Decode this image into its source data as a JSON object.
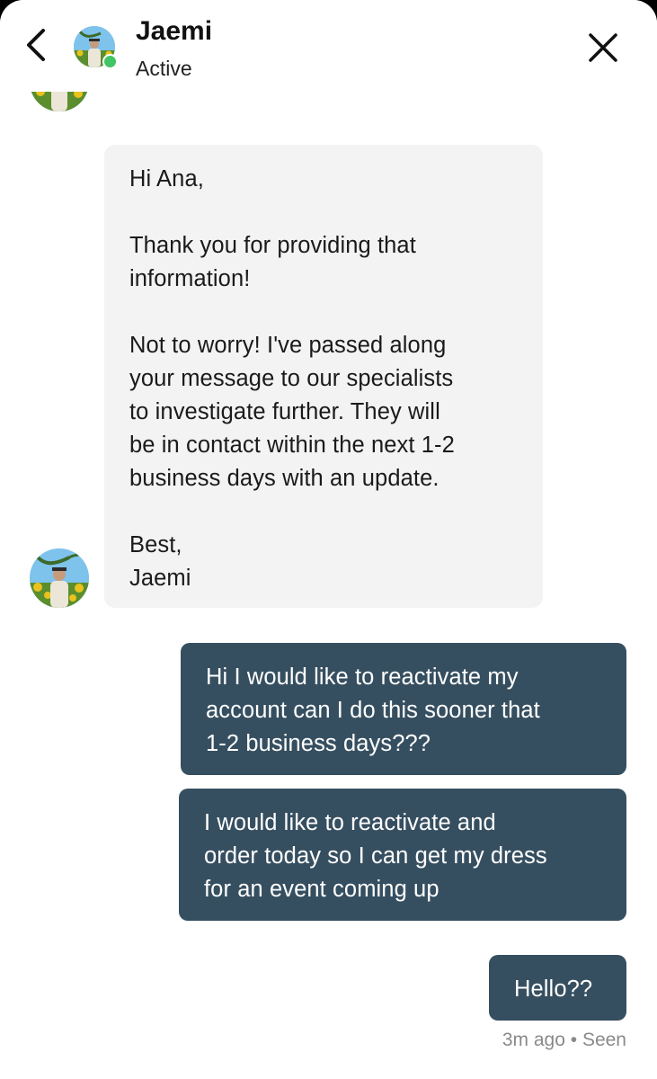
{
  "header": {
    "contact_name": "Jaemi",
    "status": "Active",
    "back_icon": "chevron-left-icon",
    "close_icon": "close-icon",
    "online_color": "#41c464"
  },
  "messages": [
    {
      "direction": "incoming",
      "paragraphs": [
        "Hi Ana,",
        "Thank you for providing that\ninformation!",
        "Not to worry! I've passed along\nyour message to our specialists\nto investigate further. They will\nbe in contact within the next 1-2\nbusiness days with an update.",
        "Best,\nJaemi"
      ]
    },
    {
      "direction": "outgoing",
      "text": "Hi I would like to reactivate my\naccount can I do this sooner that\n1-2 business days???"
    },
    {
      "direction": "outgoing",
      "text": "I would like to reactivate and\norder today so I can get my dress\nfor an event coming up"
    },
    {
      "direction": "outgoing",
      "text": "Hello??"
    }
  ],
  "receipt": "3m ago • Seen",
  "colors": {
    "incoming_bg": "#f3f3f4",
    "outgoing_bg": "#364f60",
    "receipt_text": "#8a8a8a"
  }
}
